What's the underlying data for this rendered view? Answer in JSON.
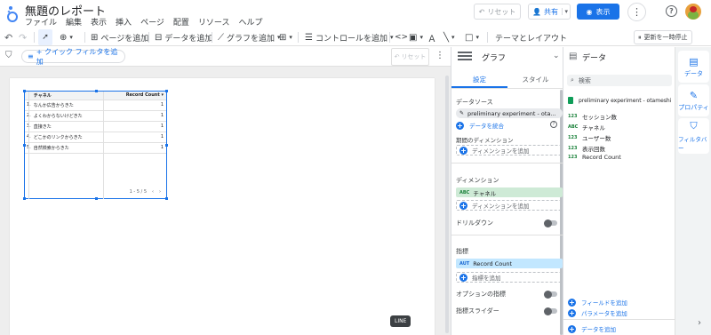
{
  "header": {
    "title": "無題のレポート",
    "menus": [
      "ファイル",
      "編集",
      "表示",
      "挿入",
      "ページ",
      "配置",
      "リソース",
      "ヘルプ"
    ],
    "reset_label": "リセット",
    "share_label": "共有",
    "view_label": "表示"
  },
  "toolbar": {
    "add_page": "ページを追加",
    "add_data": "データを追加",
    "add_chart": "グラフを追加",
    "add_control": "コントロールを追加",
    "theme": "テーマとレイアウト",
    "pause": "更新を一時停止"
  },
  "filterbar": {
    "quick_filter": "+ クイック フィルタを追加",
    "reset": "リセット"
  },
  "table": {
    "col_channel": "チャネル",
    "col_record": "Record Count",
    "rows": [
      {
        "num": "1.",
        "channel": "なんか広告からきた",
        "count": "1"
      },
      {
        "num": "2.",
        "channel": "よくわからないけどきた",
        "count": "1"
      },
      {
        "num": "3.",
        "channel": "直接きた",
        "count": "1"
      },
      {
        "num": "4.",
        "channel": "どこかのリンクからきた",
        "count": "1"
      },
      {
        "num": "5.",
        "channel": "自然検索からきた",
        "count": "1"
      }
    ],
    "pagination": "1 - 5 / 5"
  },
  "chartpanel": {
    "title": "グラフ",
    "tab_setup": "設定",
    "tab_style": "スタイル",
    "datasource_label": "データソース",
    "datasource_name": "preliminary experiment - ota...",
    "blend_label": "データを統合",
    "period_dim_label": "期間のディメンション",
    "add_dimension": "ディメンションを追加",
    "dimension_label": "ディメンション",
    "dimension_type": "ABC",
    "dimension_value": "チャネル",
    "drilldown_label": "ドリルダウン",
    "metric_label": "指標",
    "metric_type": "AUT",
    "metric_value": "Record Count",
    "add_metric": "指標を追加",
    "optional_metrics": "オプションの指標",
    "metric_slider": "指標スライダー",
    "tooltip": "LINE"
  },
  "datapanel": {
    "title": "データ",
    "search_placeholder": "検索",
    "source_name": "preliminary experiment - otameshi",
    "fields": [
      {
        "type": "123",
        "name": "セッション数"
      },
      {
        "type": "ABC",
        "name": "チャネル"
      },
      {
        "type": "123",
        "name": "ユーザー数"
      },
      {
        "type": "123",
        "name": "表示回数"
      },
      {
        "type": "123",
        "name": "Record Count"
      }
    ],
    "add_field": "フィールドを追加",
    "add_param": "パラメータを追加",
    "add_data": "データを追加"
  },
  "rightbar": {
    "data": "データ",
    "property": "プロパティ",
    "filter": "フィルタバー"
  },
  "colors": {
    "accent": "#1a73e8",
    "dim_chip": "#ceead6",
    "metric_chip": "#c2e7ff"
  }
}
